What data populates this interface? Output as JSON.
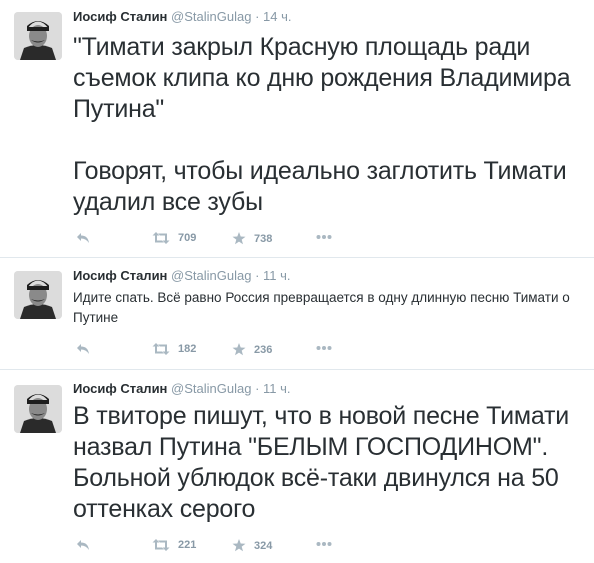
{
  "tweets": [
    {
      "author_name": "Иосиф Сталин",
      "handle": "@StalinGulag",
      "separator": "·",
      "time": "14 ч.",
      "text": "\"Тимати закрыл Красную площадь ради съемок клипа ко дню рождения Владимира Путина\"\n\nГоворят, чтобы идеально заглотить Тимати удалил все зубы",
      "retweets": "709",
      "favorites": "738"
    },
    {
      "author_name": "Иосиф Сталин",
      "handle": "@StalinGulag",
      "separator": "·",
      "time": "11 ч.",
      "text": "Идите спать. Всё равно Россия превращается в одну длинную песню Тимати о Путине",
      "retweets": "182",
      "favorites": "236"
    },
    {
      "author_name": "Иосиф Сталин",
      "handle": "@StalinGulag",
      "separator": "·",
      "time": "11 ч.",
      "text": "В твиторе пишут, что в новой песне Тимати назвал Путина \"БЕЛЫМ ГОСПОДИНОМ\". Больной ублюдок всё-таки двинулся на 50 оттенках серого",
      "retweets": "221",
      "favorites": "324"
    }
  ],
  "icons": {
    "reply": "reply-icon",
    "retweet": "retweet-icon",
    "favorite": "star-icon",
    "more": "more-icon"
  },
  "colors": {
    "text": "#292f33",
    "meta": "#8899a6",
    "action": "#aab8c2",
    "divider": "#e1e8ed"
  }
}
